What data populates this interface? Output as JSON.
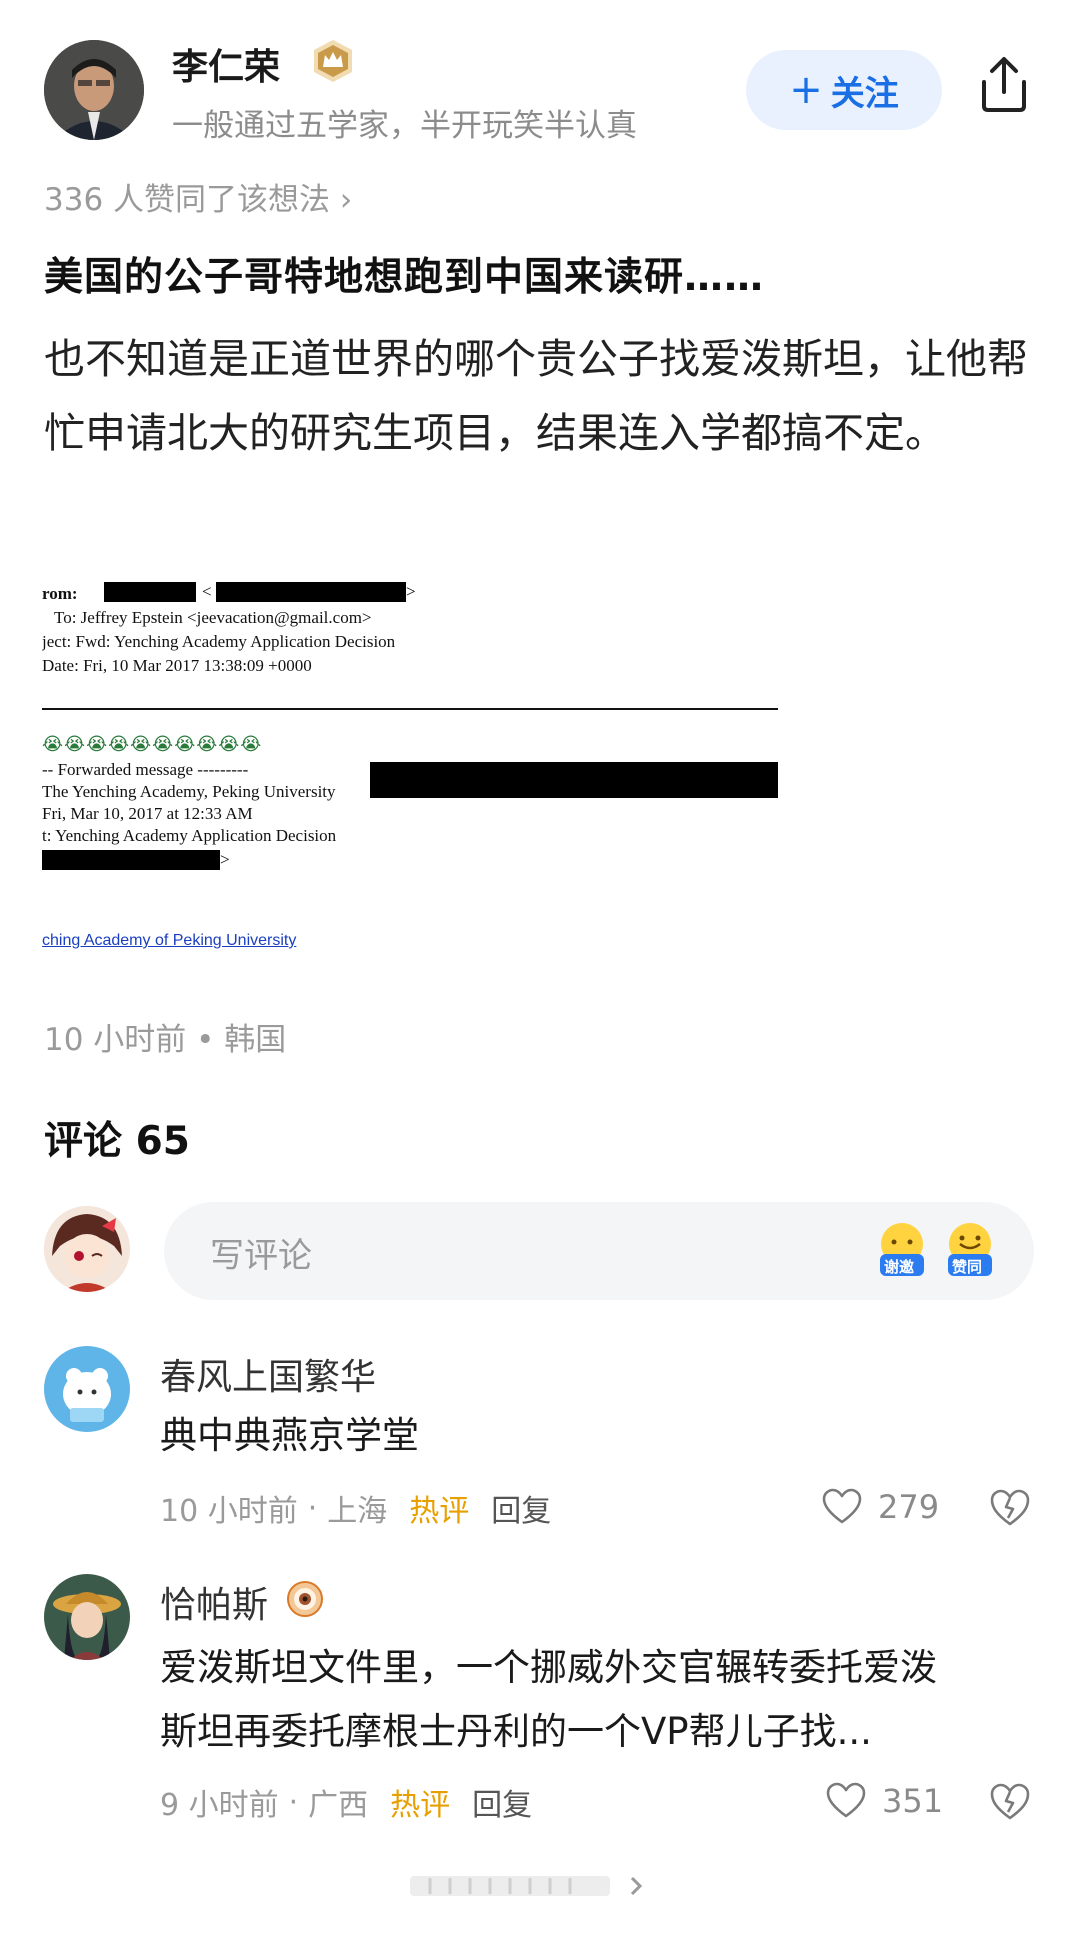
{
  "author": {
    "name": "李仁荣",
    "bio": "一般通过五学家，半开玩笑半认真",
    "follow_label": "关注",
    "follow_prefix": "+"
  },
  "post": {
    "likes_line": "336 人赞同了该想法 ›",
    "title": "美国的公子哥特地想跑到中国来读研……",
    "body": "也不知道是正道世界的哪个贵公子找爱泼斯坦，让他帮忙申请北大的研究生项目，结果连入学都搞不定。",
    "meta": "10 小时前 • 韩国"
  },
  "email_image": {
    "from_label": "rom:",
    "to_line": "To: Jeffrey Epstein <jeevacation@gmail.com>",
    "subject_line": "ject: Fwd: Yenching Academy Application Decision",
    "date_line": "Date: Fri, 10 Mar 2017 13:38:09 +0000",
    "emojis": "😭😭😭😭😭😭😭😭😭😭",
    "forwarded": "-- Forwarded message ---------",
    "fw_from": "The Yenching Academy, Peking University",
    "fw_date": "Fri, Mar 10, 2017 at 12:33 AM",
    "fw_subject": "t: Yenching Academy Application Decision",
    "link": "ching Academy of Peking University"
  },
  "comments_section": {
    "header": "评论 65",
    "composer_placeholder": "写评论",
    "emoji_btn_1": "谢邀",
    "emoji_btn_2": "赞同"
  },
  "comments": [
    {
      "name": "春风上国繁华",
      "text": "典中典燕京学堂",
      "time": "10 小时前",
      "location": "上海",
      "hot": "热评",
      "reply": "回复",
      "likes": "279"
    },
    {
      "name": "恰帕斯",
      "text_line1": "爱泼斯坦文件里，一个挪威外交官辗转委托爱泼",
      "text_line2": "斯坦再委托摩根士丹利的一个VP帮儿子找...",
      "time": "9 小时前",
      "location": "广西",
      "hot": "热评",
      "reply": "回复",
      "likes": "351"
    }
  ],
  "colors": {
    "accent": "#1b6fe5",
    "hot": "#e8a000",
    "muted": "#9a9a9a"
  }
}
